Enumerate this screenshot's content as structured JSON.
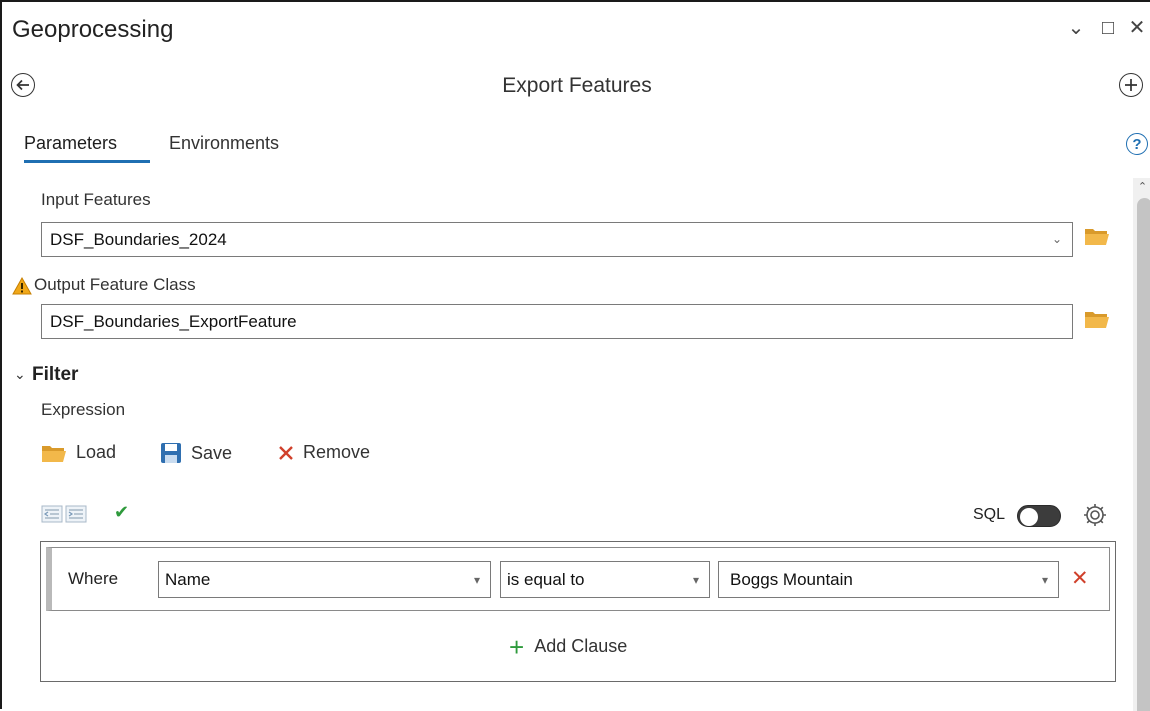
{
  "pane": {
    "title": "Geoprocessing",
    "controls": {
      "options": "⌄",
      "maximize": "□",
      "close": "✕"
    }
  },
  "tool": {
    "title": "Export Features",
    "back_icon": "arrow-left-circle-icon",
    "add_icon": "plus-circle-icon"
  },
  "tabs": [
    {
      "label": "Parameters",
      "active": true
    },
    {
      "label": "Environments",
      "active": false
    }
  ],
  "help": {
    "glyph": "?"
  },
  "parameters": {
    "input_features": {
      "label": "Input Features",
      "value": "DSF_Boundaries_2024"
    },
    "output_feature_class": {
      "label": "Output Feature Class",
      "value": "DSF_Boundaries_ExportFeature",
      "warning": true
    }
  },
  "filter": {
    "section_label": "Filter",
    "expression_label": "Expression",
    "toolbar": {
      "load_label": "Load",
      "save_label": "Save",
      "remove_label": "Remove"
    },
    "sql_label": "SQL",
    "sql_toggle_on": false,
    "clause": {
      "where_label": "Where",
      "field": "Name",
      "operator": "is equal to",
      "value": "Boggs Mountain"
    },
    "add_clause_label": "Add Clause"
  },
  "colors": {
    "accent": "#1f6fb2",
    "folder": "#f2b84a",
    "remove": "#d0402b",
    "add": "#2e9a3c",
    "warning": "#f0a81a"
  }
}
